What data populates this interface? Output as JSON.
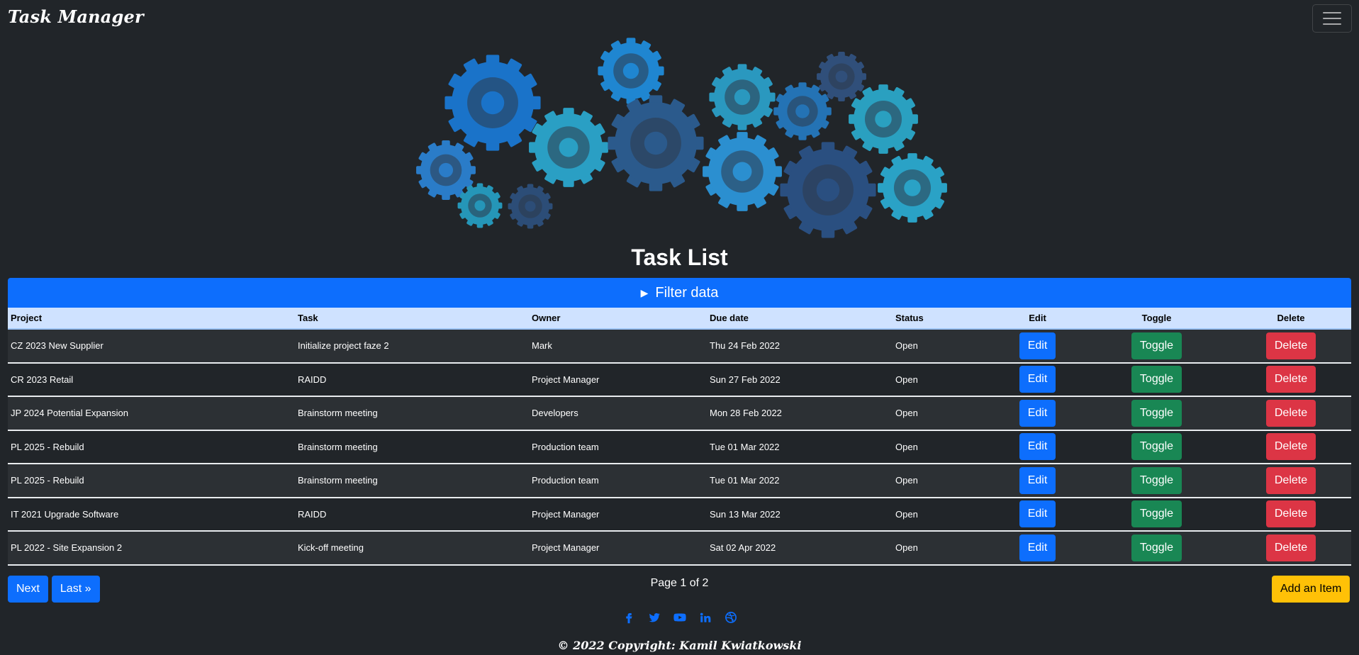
{
  "navbar": {
    "brand": "Task Manager",
    "menu_icon": "hamburger-icon"
  },
  "hero": {
    "image_icon": "gears-illustration"
  },
  "page_title": "Task List",
  "filter": {
    "label": "Filter data",
    "icon": "triangle-right-icon"
  },
  "table": {
    "headers": {
      "project": "Project",
      "task": "Task",
      "owner": "Owner",
      "due": "Due date",
      "status": "Status",
      "edit": "Edit",
      "toggle": "Toggle",
      "delete": "Delete"
    },
    "rows": [
      {
        "project": "CZ 2023 New Supplier",
        "task": "Initialize project faze 2",
        "owner": "Mark",
        "due": "Thu 24 Feb 2022",
        "status": "Open",
        "edit": "Edit",
        "toggle": "Toggle",
        "delete": "Delete"
      },
      {
        "project": "CR 2023 Retail",
        "task": "RAIDD",
        "owner": "Project Manager",
        "due": "Sun 27 Feb 2022",
        "status": "Open",
        "edit": "Edit",
        "toggle": "Toggle",
        "delete": "Delete"
      },
      {
        "project": "JP 2024 Potential Expansion",
        "task": "Brainstorm meeting",
        "owner": "Developers",
        "due": "Mon 28 Feb 2022",
        "status": "Open",
        "edit": "Edit",
        "toggle": "Toggle",
        "delete": "Delete"
      },
      {
        "project": "PL 2025 - Rebuild",
        "task": "Brainstorm meeting",
        "owner": "Production team",
        "due": "Tue 01 Mar 2022",
        "status": "Open",
        "edit": "Edit",
        "toggle": "Toggle",
        "delete": "Delete"
      },
      {
        "project": "PL 2025 - Rebuild",
        "task": "Brainstorm meeting",
        "owner": "Production team",
        "due": "Tue 01 Mar 2022",
        "status": "Open",
        "edit": "Edit",
        "toggle": "Toggle",
        "delete": "Delete"
      },
      {
        "project": "IT 2021 Upgrade Software",
        "task": "RAIDD",
        "owner": "Project Manager",
        "due": "Sun 13 Mar 2022",
        "status": "Open",
        "edit": "Edit",
        "toggle": "Toggle",
        "delete": "Delete"
      },
      {
        "project": "PL 2022 - Site Expansion 2",
        "task": "Kick-off meeting",
        "owner": "Project Manager",
        "due": "Sat 02 Apr 2022",
        "status": "Open",
        "edit": "Edit",
        "toggle": "Toggle",
        "delete": "Delete"
      }
    ]
  },
  "pagination": {
    "next": "Next",
    "last": "Last »",
    "info": "Page 1 of 2"
  },
  "add_item": "Add an Item",
  "footer": {
    "social": [
      "facebook-icon",
      "twitter-icon",
      "youtube-icon",
      "linkedin-icon",
      "dribbble-icon"
    ],
    "copyright": "© 2022 Copyright: Kamil Kwiatkowski"
  },
  "colors": {
    "background": "#212529",
    "primary": "#0d6efd",
    "success": "#198754",
    "danger": "#dc3545",
    "warning": "#ffc107",
    "table_header": "#cfe2ff"
  }
}
